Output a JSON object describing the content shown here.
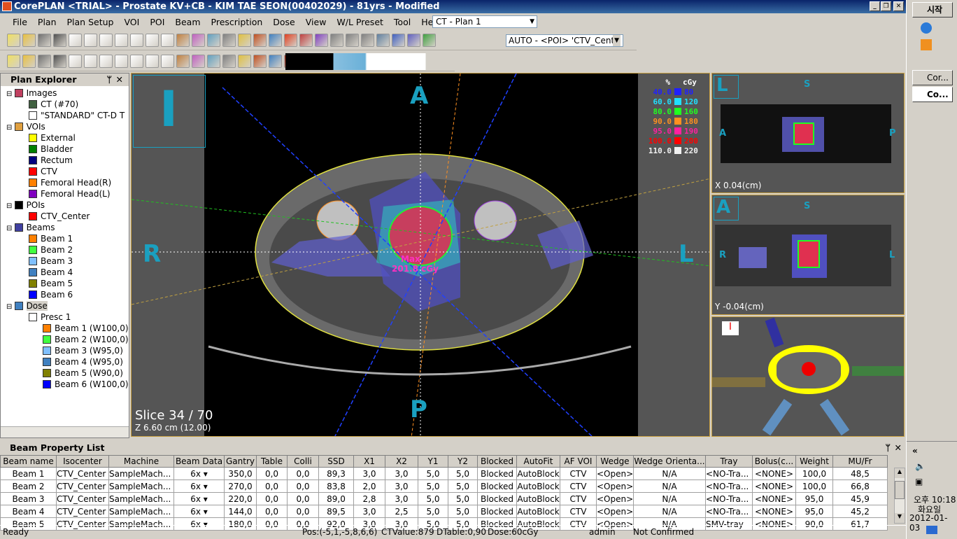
{
  "window": {
    "title": "CorePLAN <TRIAL> - Prostate KV+CB - KIM TAE SEON(00402029) - 81yrs - Modified"
  },
  "menu": [
    "File",
    "Plan",
    "Plan Setup",
    "VOI",
    "POI",
    "Beam",
    "Prescription",
    "Dose",
    "View",
    "W/L Preset",
    "Tool",
    "Help"
  ],
  "plan_select": "CT - Plan 1",
  "poi_select": "AUTO - <POI> 'CTV_Cente",
  "explorer": {
    "title": "Plan Explorer",
    "tree": [
      {
        "label": "Images",
        "level": 0,
        "color": "#c04060"
      },
      {
        "label": "CT (#70)",
        "level": 1,
        "color": "#406040"
      },
      {
        "label": "\"STANDARD\" CT-D T",
        "level": 1,
        "color": "#ffffff"
      },
      {
        "label": "VOIs",
        "level": 0,
        "color": "#e0a040"
      },
      {
        "label": "External",
        "level": 1,
        "color": "#ffff00"
      },
      {
        "label": "Bladder",
        "level": 1,
        "color": "#008000"
      },
      {
        "label": "Rectum",
        "level": 1,
        "color": "#000080"
      },
      {
        "label": "CTV",
        "level": 1,
        "color": "#ff0000"
      },
      {
        "label": "Femoral Head(R)",
        "level": 1,
        "color": "#ff8000"
      },
      {
        "label": "Femoral Head(L)",
        "level": 1,
        "color": "#8000c0"
      },
      {
        "label": "POIs",
        "level": 0,
        "color": "#000000"
      },
      {
        "label": "CTV_Center",
        "level": 1,
        "color": "#ff0000"
      },
      {
        "label": "Beams",
        "level": 0,
        "color": "#4040a0"
      },
      {
        "label": "Beam 1",
        "level": 1,
        "color": "#ff8000"
      },
      {
        "label": "Beam 2",
        "level": 1,
        "color": "#40ff40"
      },
      {
        "label": "Beam 3",
        "level": 1,
        "color": "#80c0ff"
      },
      {
        "label": "Beam 4",
        "level": 1,
        "color": "#4080c0"
      },
      {
        "label": "Beam 5",
        "level": 1,
        "color": "#808000"
      },
      {
        "label": "Beam 6",
        "level": 1,
        "color": "#0000ff"
      },
      {
        "label": "Dose",
        "level": 0,
        "color": "#4080c0"
      },
      {
        "label": "Presc 1",
        "level": 1,
        "color": "#ffffff"
      },
      {
        "label": "Beam 1 (W100,0)",
        "level": 2,
        "color": "#ff8000"
      },
      {
        "label": "Beam 2 (W100,0)",
        "level": 2,
        "color": "#40ff40"
      },
      {
        "label": "Beam 3 (W95,0)",
        "level": 2,
        "color": "#80c0ff"
      },
      {
        "label": "Beam 4 (W95,0)",
        "level": 2,
        "color": "#4080c0"
      },
      {
        "label": "Beam 5 (W90,0)",
        "level": 2,
        "color": "#808000"
      },
      {
        "label": "Beam 6 (W100,0)",
        "level": 2,
        "color": "#0000ff"
      }
    ]
  },
  "axial": {
    "orientation": "I",
    "top": "A",
    "bottom": "P",
    "left": "R",
    "right": "L",
    "slice": "Slice  34 / 70",
    "z": "Z  6.60 cm (12.00)",
    "max_label": "Max",
    "max_value": "201.8 cGy"
  },
  "isodose": {
    "h_pct": "%",
    "h_cgy": "cGy",
    "levels": [
      {
        "pct": "40.0",
        "cgy": "80",
        "color": "#2020ff"
      },
      {
        "pct": "60.0",
        "cgy": "120",
        "color": "#20e0ff"
      },
      {
        "pct": "80.0",
        "cgy": "160",
        "color": "#20ff20"
      },
      {
        "pct": "90.0",
        "cgy": "180",
        "color": "#ff9020"
      },
      {
        "pct": "95.0",
        "cgy": "190",
        "color": "#ff20a0"
      },
      {
        "pct": "100.0",
        "cgy": "200",
        "color": "#ff0000"
      },
      {
        "pct": "110.0",
        "cgy": "220",
        "color": "#f0f0f0"
      }
    ]
  },
  "sagittal": {
    "orientation": "L",
    "top": "S",
    "left": "A",
    "right": "P",
    "readout": "X  0.04(cm)"
  },
  "coronal": {
    "orientation": "A",
    "top": "S",
    "left": "R",
    "right": "L",
    "readout": "Y  -0.04(cm)"
  },
  "view3d": {
    "orientation": "I"
  },
  "bpl": {
    "title": "Beam Property List",
    "columns": [
      "Beam name",
      "Isocenter",
      "Machine",
      "Beam Data",
      "Gantry",
      "Table",
      "Colli",
      "SSD",
      "X1",
      "X2",
      "Y1",
      "Y2",
      "Blocked",
      "AutoFit",
      "AF VOI",
      "Wedge",
      "Wedge Orienta...",
      "Tray",
      "Bolus(c...",
      "Weight",
      "MU/Fr"
    ],
    "rows": [
      [
        "Beam 1",
        "CTV_Center",
        "SampleMach...",
        "6x",
        "350,0",
        "0,0",
        "0,0",
        "89,3",
        "3,0",
        "3,0",
        "5,0",
        "5,0",
        "Blocked",
        "AutoBlock",
        "CTV",
        "<Open>",
        "N/A",
        "<NO-Tra...",
        "<NONE>",
        "100,0",
        "48,5"
      ],
      [
        "Beam 2",
        "CTV_Center",
        "SampleMach...",
        "6x",
        "270,0",
        "0,0",
        "0,0",
        "83,8",
        "2,0",
        "3,0",
        "5,0",
        "5,0",
        "Blocked",
        "AutoBlock",
        "CTV",
        "<Open>",
        "N/A",
        "<NO-Tra...",
        "<NONE>",
        "100,0",
        "66,8"
      ],
      [
        "Beam 3",
        "CTV_Center",
        "SampleMach...",
        "6x",
        "220,0",
        "0,0",
        "0,0",
        "89,0",
        "2,8",
        "3,0",
        "5,0",
        "5,0",
        "Blocked",
        "AutoBlock",
        "CTV",
        "<Open>",
        "N/A",
        "<NO-Tra...",
        "<NONE>",
        "95,0",
        "45,9"
      ],
      [
        "Beam 4",
        "CTV_Center",
        "SampleMach...",
        "6x",
        "144,0",
        "0,0",
        "0,0",
        "89,5",
        "3,0",
        "2,5",
        "5,0",
        "5,0",
        "Blocked",
        "AutoBlock",
        "CTV",
        "<Open>",
        "N/A",
        "<NO-Tra...",
        "<NONE>",
        "95,0",
        "45,2"
      ],
      [
        "Beam 5",
        "CTV_Center",
        "SampleMach...",
        "6x",
        "180,0",
        "0,0",
        "0,0",
        "92,0",
        "3,0",
        "3,0",
        "5,0",
        "5,0",
        "Blocked",
        "AutoBlock",
        "CTV",
        "<Open>",
        "N/A",
        "SMV-tray",
        "<NONE>",
        "90,0",
        "61,7"
      ]
    ]
  },
  "status": {
    "ready": "Ready",
    "pos": "Pos:(-5,1,-5,8,6,6)",
    "ctvalue": "CTValue:879",
    "dtable": "DTable:0,90",
    "dose": "Dose:60cGy",
    "user": "admin",
    "confirm": "Not Confirmed"
  },
  "taskbar": {
    "start": "시작",
    "apps": [
      "Cor...",
      "Co..."
    ],
    "collapse": "«",
    "time": "오후 10:18",
    "day": "화요일",
    "date": "2012-01-03"
  }
}
